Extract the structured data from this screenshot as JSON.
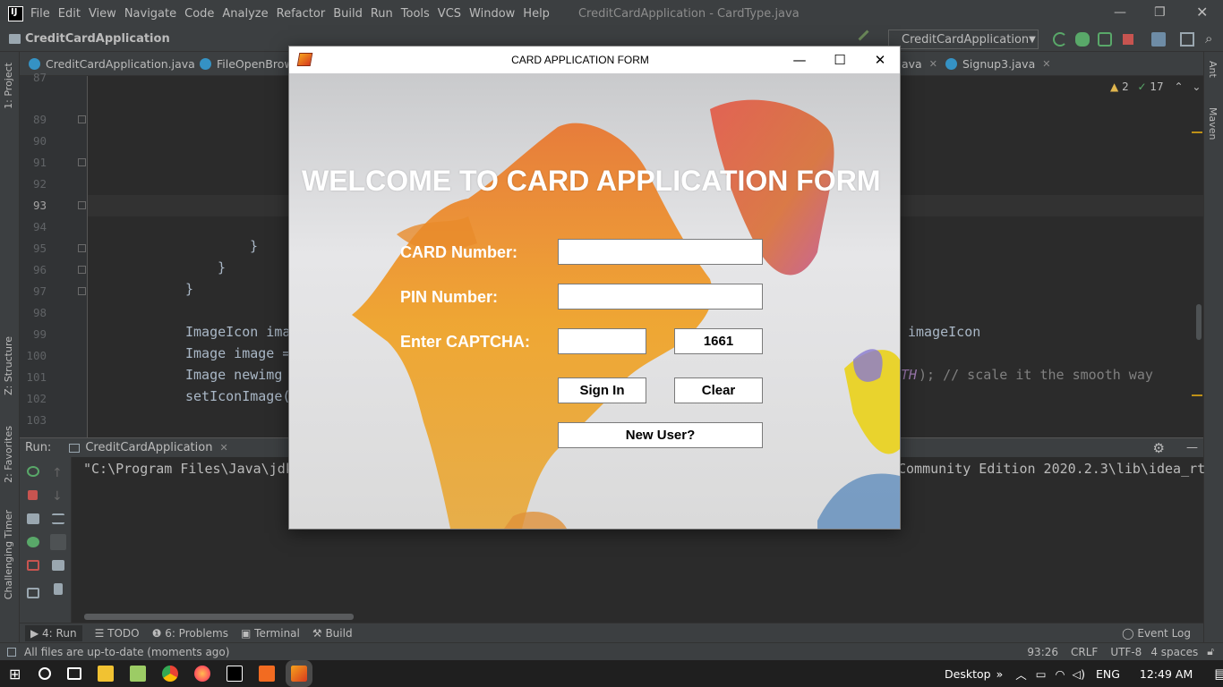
{
  "menubar": {
    "items": [
      "File",
      "Edit",
      "View",
      "Navigate",
      "Code",
      "Analyze",
      "Refactor",
      "Build",
      "Run",
      "Tools",
      "VCS",
      "Window",
      "Help"
    ],
    "window_title": "CreditCardApplication - CardType.java"
  },
  "navbar": {
    "project": "CreditCardApplication",
    "run_config": "CreditCardApplication"
  },
  "left_tabs": [
    "1: Project",
    "Z: Structure",
    "2: Favorites",
    "Challenging Timer"
  ],
  "right_tabs": [
    "Ant",
    "Maven"
  ],
  "editor_tabs": [
    {
      "label": "CreditCardApplication.java"
    },
    {
      "label": "FileOpenBrows"
    },
    {
      "label": "ava"
    },
    {
      "label": "Signup3.java"
    }
  ],
  "inspections": {
    "warnings": "2",
    "weak": "17"
  },
  "gutter": {
    "lines": [
      "87",
      "89",
      "90",
      "91",
      "92",
      "93",
      "94",
      "95",
      "96",
      "97",
      "98",
      "99",
      "100",
      "101",
      "102",
      "103"
    ]
  },
  "code": {
    "l95": "}",
    "l96": "}",
    "l97": "}",
    "l99": "ImageIcon ima",
    "l99_right": "imageIcon",
    "l100": "Image image =",
    "l101a": "Image newimg",
    "l101_right_const": "TH",
    "l101_right_rest": "); // scale it the smooth way",
    "l102": "setIconImage("
  },
  "run_panel": {
    "label": "Run:",
    "tab": "CreditCardApplication",
    "console_left": "\"C:\\Program Files\\Java\\jdk",
    "console_right": "Community Edition 2020.2.3\\lib\\idea_rt"
  },
  "bottom_tabs": [
    "4: Run",
    "TODO",
    "6: Problems",
    "Terminal",
    "Build"
  ],
  "event_log": "Event Log",
  "status": {
    "message": "All files are up-to-date (moments ago)",
    "position": "93:26",
    "line_sep": "CRLF",
    "encoding": "UTF-8",
    "indent": "4 spaces"
  },
  "taskbar": {
    "desktop": "Desktop",
    "lang": "ENG",
    "time": "12:49 AM"
  },
  "dialog": {
    "title": "CARD APPLICATION FORM",
    "welcome": "WELCOME TO CARD APPLICATION FORM",
    "card_label": "CARD Number:",
    "card_value": "",
    "pin_label": "PIN Number:",
    "pin_value": "",
    "captcha_label": "Enter CAPTCHA:",
    "captcha_value": "",
    "captcha_code": "1661",
    "sign_in": "Sign In",
    "clear": "Clear",
    "new_user": "New User?"
  },
  "colors": {
    "ide_bg": "#2b2b2b",
    "ide_panel": "#3c3f41",
    "map_orange": "#f0a020",
    "welcome_text": "#ffffff"
  }
}
